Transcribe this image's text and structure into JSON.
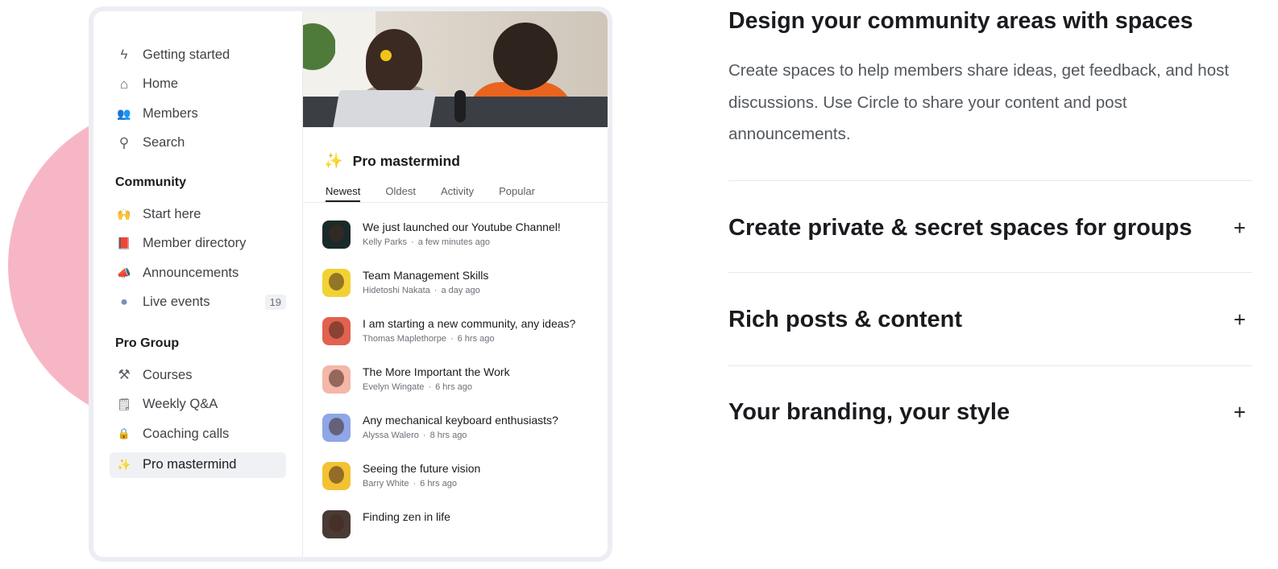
{
  "sidebar": {
    "top_items": [
      {
        "label": "Getting started",
        "icon": "bolt-icon",
        "glyph": "ϟ"
      },
      {
        "label": "Home",
        "icon": "home-icon",
        "glyph": "⌂"
      },
      {
        "label": "Members",
        "icon": "members-icon",
        "glyph": "👥"
      },
      {
        "label": "Search",
        "icon": "search-icon",
        "glyph": "⚲"
      }
    ],
    "community_title": "Community",
    "community_items": [
      {
        "label": "Start here",
        "icon": "raised-hands-icon",
        "glyph": "🙌"
      },
      {
        "label": "Member directory",
        "icon": "book-icon",
        "glyph": "📕"
      },
      {
        "label": "Announcements",
        "icon": "megaphone-icon",
        "glyph": "📣"
      },
      {
        "label": "Live events",
        "icon": "record-button-icon",
        "glyph": "⏺",
        "count": "19"
      }
    ],
    "group_title": "Pro Group",
    "group_items": [
      {
        "label": "Courses",
        "icon": "tools-icon",
        "glyph": "⚒"
      },
      {
        "label": "Weekly Q&A",
        "icon": "notepad-icon",
        "glyph": "🗒"
      },
      {
        "label": "Coaching calls",
        "icon": "lock-icon",
        "glyph": "🔒"
      },
      {
        "label": "Pro mastermind",
        "icon": "sparkles-icon",
        "glyph": "✨"
      }
    ]
  },
  "space": {
    "title": "Pro mastermind",
    "icon_glyph": "✨",
    "tabs": [
      "Newest",
      "Oldest",
      "Activity",
      "Popular"
    ],
    "posts": [
      {
        "title": "We just launched our Youtube Channel!",
        "author": "Kelly Parks",
        "time": "a few minutes ago",
        "avatar_bg": "#1a2a2a"
      },
      {
        "title": "Team Management Skills",
        "author": "Hidetoshi Nakata",
        "time": "a day ago",
        "avatar_bg": "#f2d233"
      },
      {
        "title": "I am starting a new community, any ideas?",
        "author": "Thomas Maplethorpe",
        "time": "6 hrs ago",
        "avatar_bg": "#e0624f"
      },
      {
        "title": "The More Important the Work",
        "author": "Evelyn Wingate",
        "time": "6 hrs ago",
        "avatar_bg": "#f4b7a8"
      },
      {
        "title": "Any mechanical keyboard enthusiasts?",
        "author": "Alyssa Walero",
        "time": "8 hrs ago",
        "avatar_bg": "#8fa6e8"
      },
      {
        "title": "Seeing the future vision",
        "author": "Barry White",
        "time": "6 hrs ago",
        "avatar_bg": "#f2c233"
      },
      {
        "title": "Finding zen in life",
        "author": "",
        "time": "",
        "avatar_bg": "#4a3a35"
      }
    ]
  },
  "feature": {
    "heading": "Design your community areas with spaces",
    "description": "Create spaces to help members share ideas, get feedback, and host discussions. Use Circle to share your content and post announcements.",
    "accordion": [
      {
        "title": "Create private & secret spaces for groups",
        "expand_glyph": "+"
      },
      {
        "title": "Rich posts & content",
        "expand_glyph": "+"
      },
      {
        "title": "Your branding, your style",
        "expand_glyph": "+"
      }
    ]
  },
  "colors": {
    "accent_pink": "#f7b6c6",
    "text_dark": "#191b1f",
    "text_muted": "#53575e"
  }
}
